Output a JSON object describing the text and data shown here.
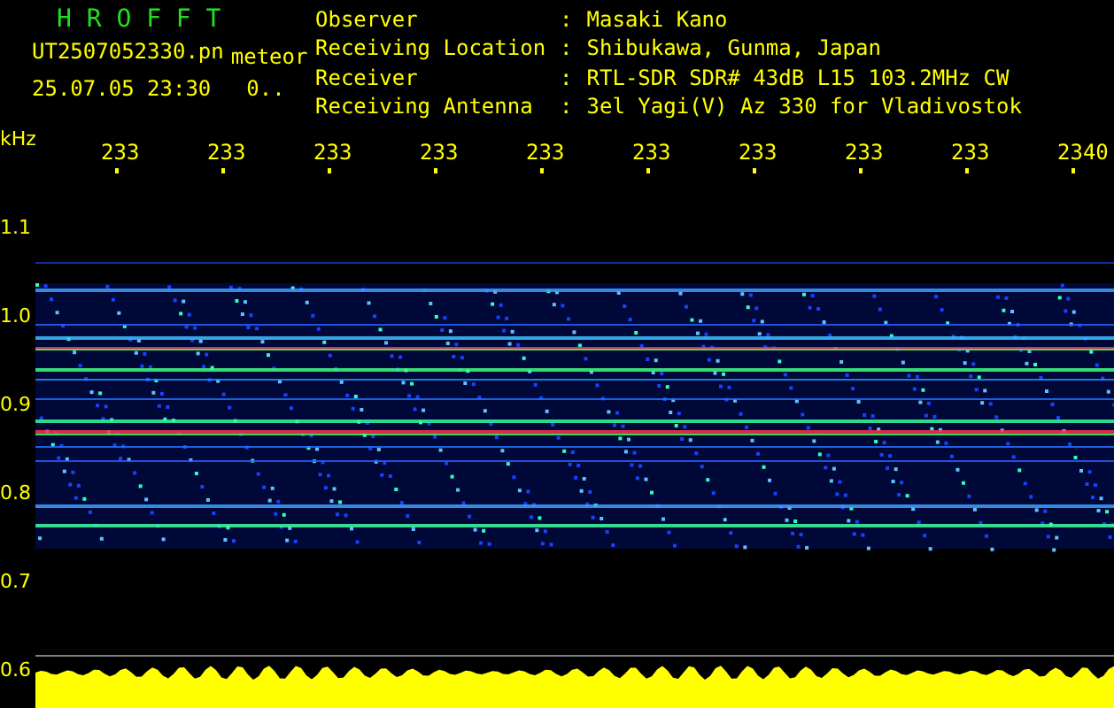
{
  "header": {
    "title": "H R O F F T",
    "filename": "UT2507052330.pn",
    "mode": "meteor",
    "datetime": "25.07.05 23:30",
    "counter": "0..",
    "fields": [
      {
        "label": "Observer",
        "separator": ":",
        "value": "Masaki Kano"
      },
      {
        "label": "Receiving Location",
        "separator": ":",
        "value": "Shibukawa, Gunma, Japan"
      },
      {
        "label": "Receiver",
        "separator": ":",
        "value": "RTL-SDR SDR# 43dB L15 103.2MHz CW"
      },
      {
        "label": "Receiving Antenna",
        "separator": ":",
        "value": "3el Yagi(V) Az 330 for Vladivostok"
      }
    ]
  },
  "x_axis": {
    "unit": "kHz",
    "labels": [
      "233",
      "233",
      "233",
      "233",
      "233",
      "233",
      "233",
      "233",
      "233",
      "2340"
    ]
  },
  "y_axis": {
    "labels": [
      "1.1",
      "1.0",
      "0.9",
      "0.8",
      "0.7",
      "0.6"
    ]
  }
}
